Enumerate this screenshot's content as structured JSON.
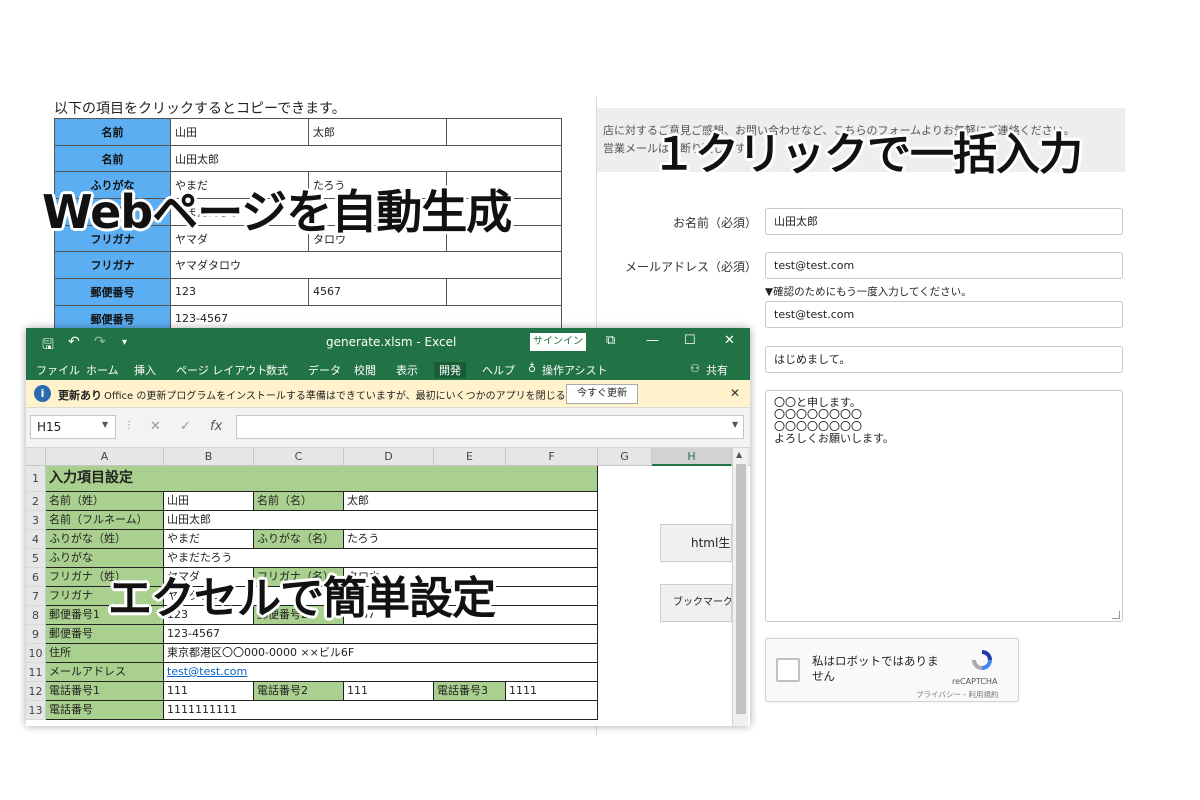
{
  "webpage": {
    "intro": "以下の項目をクリックするとコピーできます。",
    "rows": [
      {
        "label": "名前",
        "v1": "山田",
        "v2": "太郎",
        "v3": ""
      },
      {
        "label": "名前",
        "v1": "山田太郎"
      },
      {
        "label": "ふりがな",
        "v1": "やまだ",
        "v2": "たろう",
        "v3": ""
      },
      {
        "label": "ふりがな",
        "v1": "やまだたろう"
      },
      {
        "label": "フリガナ",
        "v1": "ヤマダ",
        "v2": "タロウ",
        "v3": ""
      },
      {
        "label": "フリガナ",
        "v1": "ヤマダタロウ"
      },
      {
        "label": "郵便番号",
        "v1": "123",
        "v2": "4567",
        "v3": ""
      },
      {
        "label": "郵便番号",
        "v1": "123-4567"
      }
    ]
  },
  "form": {
    "notice_line1": "店に対するご意見ご感想、お問い合わせなど、こちらのフォームよりお気軽にご連絡ください。",
    "notice_line2": "営業メールはお断り致します。",
    "name_label": "お名前（必須）",
    "name_value": "山田太郎",
    "email_label": "メールアドレス（必須）",
    "email_value": "test@test.com",
    "confirm_note": "▼確認のためにもう一度入力してください。",
    "email_confirm_value": "test@test.com",
    "subject_value": "はじめまして。",
    "message_lines": [
      "〇〇と申します。",
      "〇〇〇〇〇〇〇〇",
      "〇〇〇〇〇〇〇〇",
      "よろしくお願いします。"
    ],
    "recaptcha": {
      "label": "私はロボットではありません",
      "brand": "reCAPTCHA",
      "links": "プライバシー - 利用規約"
    }
  },
  "excel": {
    "title": "generate.xlsm  -  Excel",
    "signin": "サインイン",
    "window_buttons": {
      "restore": "⧉",
      "minimize": "—",
      "maximize": "☐",
      "close": "✕"
    },
    "ribbon_tabs": [
      "ファイル",
      "ホーム",
      "挿入",
      "ページ レイアウト",
      "数式",
      "データ",
      "校閲",
      "表示",
      "開発",
      "ヘルプ",
      "操作アシスト",
      "共有"
    ],
    "message_bar": {
      "title": "更新あり",
      "text": "Office の更新プログラムをインストールする準備はできていますが、最初にいくつかのアプリを閉じる必要があります。",
      "button": "今すぐ更新"
    },
    "name_box": "H15",
    "columns": [
      "A",
      "B",
      "C",
      "D",
      "E",
      "F",
      "G",
      "H"
    ],
    "sheet_title": "入力項目設定",
    "rows": [
      {
        "n": "1"
      },
      {
        "n": "2",
        "a": "名前（姓）",
        "b": "山田",
        "c": "名前（名）",
        "d": "太郎"
      },
      {
        "n": "3",
        "a": "名前（フルネーム）",
        "b": "山田太郎"
      },
      {
        "n": "4",
        "a": "ふりがな（姓）",
        "b": "やまだ",
        "c": "ふりがな（名）",
        "d": "たろう"
      },
      {
        "n": "5",
        "a": "ふりがな",
        "b": "やまだたろう"
      },
      {
        "n": "6",
        "a": "フリガナ（姓）",
        "b": "ヤマダ",
        "c": "フリガナ（名）",
        "d": "タロウ"
      },
      {
        "n": "7",
        "a": "フリガナ",
        "b": "ヤマダタロウ"
      },
      {
        "n": "8",
        "a": "郵便番号1",
        "b": "123",
        "c": "郵便番号2",
        "d": "4567"
      },
      {
        "n": "9",
        "a": "郵便番号",
        "b": "123-4567"
      },
      {
        "n": "10",
        "a": "住所",
        "b": "東京都港区〇〇000-0000 ××ビル6F"
      },
      {
        "n": "11",
        "a": "メールアドレス",
        "b": "test@test.com"
      },
      {
        "n": "12",
        "a": "電話番号1",
        "b": "111",
        "c": "電話番号2",
        "d": "111",
        "e": "電話番号3",
        "f": "1111"
      },
      {
        "n": "13",
        "a": "電話番号",
        "b": "1111111111"
      }
    ],
    "buttons": {
      "html": "html生成",
      "bookmark": "ブックマーク"
    }
  },
  "captions": {
    "web": "Webページを自動生成",
    "click": "１クリックで一括入力",
    "excel": "エクセルで簡単設定"
  },
  "colors": {
    "excel_green": "#217346",
    "header_cell_green": "#a9d08e",
    "web_label_blue": "#5baef2",
    "message_bar_yellow": "#fff2cc"
  }
}
